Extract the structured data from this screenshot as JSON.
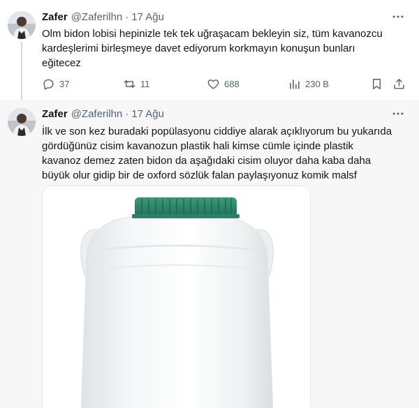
{
  "tweets": [
    {
      "author_name": "Zafer",
      "handle": "@Zaferilhn",
      "separator": "·",
      "time": "17 Ağu",
      "text_lines": [
        "Olm bidon lobisi hepinizle tek tek uğraşacam bekleyin siz, tüm kavanozcu",
        "kardeşlerimi birleşmeye davet ediyorum korkmayın konuşun bunları",
        "eğitecez"
      ],
      "replies": "37",
      "retweets": "11",
      "likes": "688",
      "views": "230 B"
    },
    {
      "author_name": "Zafer",
      "handle": "@Zaferilhn",
      "separator": "·",
      "time": "17 Ağu",
      "text_lines": [
        "İlk ve son kez buradaki popülasyonu ciddiye alarak açıklıyorum bu yukarıda",
        "gördüğünüz cisim kavanozun plastik hali  kimse cümle içinde plastik",
        "kavanoz demez  zaten bidon da aşağıdaki cisim oluyor daha kaba daha",
        "büyük olur gidip bir de oxford sözlük falan paylaşıyonuz komik malsf"
      ]
    }
  ],
  "icons": {
    "more": "more-dots-icon",
    "reply": "reply-icon",
    "retweet": "retweet-icon",
    "like": "heart-icon",
    "views": "views-chart-icon",
    "bookmark": "bookmark-icon",
    "share": "share-icon"
  },
  "colors": {
    "text": "#0f1419",
    "secondary": "#536471",
    "thread_line": "#cfd9de",
    "cap_green": "#2f8a6a",
    "bg_highlight": "#f7f7f7"
  }
}
